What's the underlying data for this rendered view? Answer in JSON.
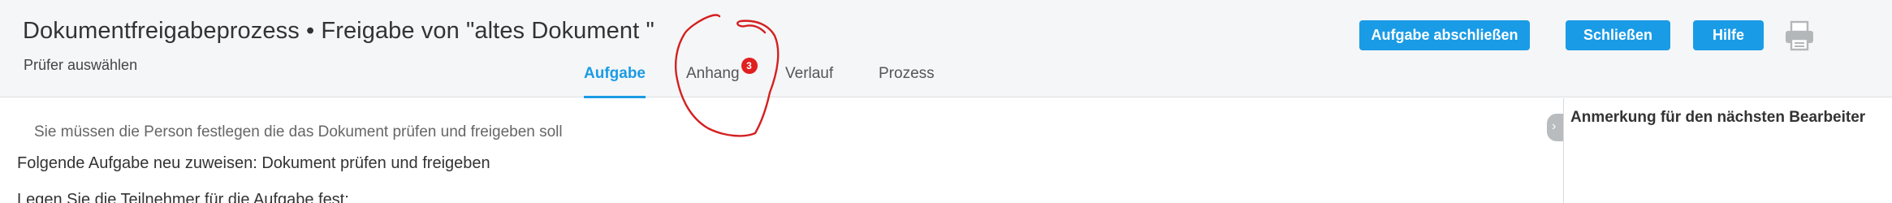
{
  "header": {
    "title": "Dokumentfreigabeprozess • Freigabe von \"altes Dokument \"",
    "subtitle": "Prüfer auswählen"
  },
  "tabs": [
    {
      "label": "Aufgabe",
      "active": true
    },
    {
      "label": "Anhang",
      "badge": "3"
    },
    {
      "label": "Verlauf"
    },
    {
      "label": "Prozess"
    }
  ],
  "buttons": {
    "complete_task": "Aufgabe abschließen",
    "close": "Schließen",
    "help": "Hilfe"
  },
  "icons": {
    "print": "printer-icon",
    "collapse": "chevron-right-icon"
  },
  "main": {
    "hint": "Sie müssen die Person festlegen die das Dokument prüfen und freigeben soll",
    "reassign_line": "Folgende Aufgabe neu zuweisen: Dokument prüfen und freigeben",
    "participants_line": "Legen Sie die Teilnehmer für die Aufgabe fest:"
  },
  "right_panel": {
    "title": "Anmerkung für den nächsten Bearbeiter",
    "collapse_glyph": "›"
  },
  "colors": {
    "accent": "#1a9be6",
    "badge": "#e02020",
    "annotation": "#d42020",
    "header_bg": "#f5f6f7"
  }
}
